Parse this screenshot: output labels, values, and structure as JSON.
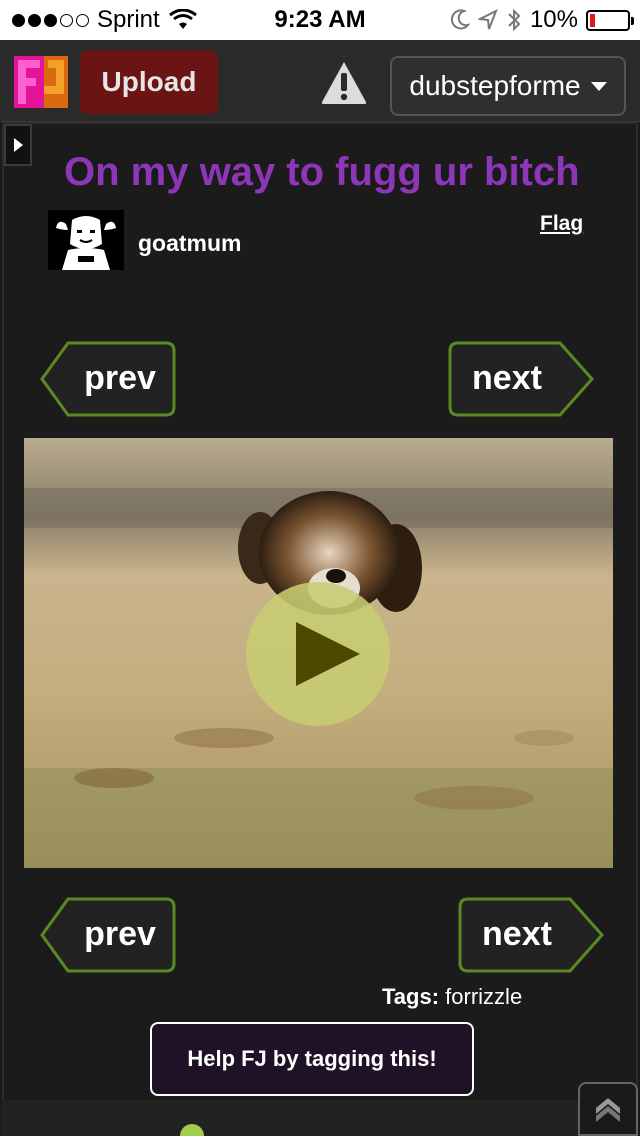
{
  "status_bar": {
    "carrier": "Sprint",
    "time": "9:23 AM",
    "battery": "10%",
    "battery_level": 0.1,
    "signal_dots_filled": 3,
    "signal_dots_total": 5
  },
  "header": {
    "upload_label": "Upload",
    "username": "dubstepforme"
  },
  "post": {
    "title": "On my way to fugg ur bitch",
    "author": "goatmum",
    "flag_label": "Flag"
  },
  "nav": {
    "prev_label": "prev",
    "next_label": "next"
  },
  "tags": {
    "label": "Tags:",
    "value": "forrizzle"
  },
  "help_button_label": "Help FJ by tagging this!",
  "colors": {
    "title": "#8e36b8",
    "upload_bg": "#6b1414",
    "nav_border": "#5a8a22",
    "battery_low": "#e01818"
  }
}
